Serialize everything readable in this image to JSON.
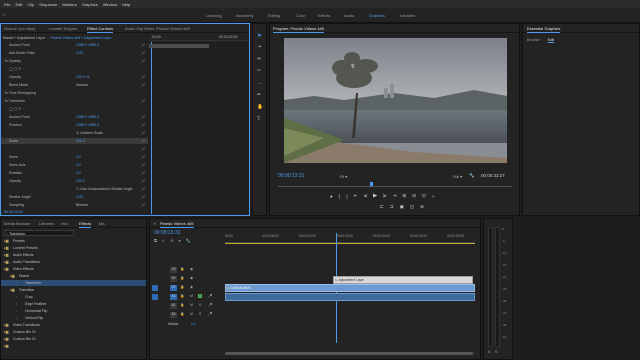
{
  "menu": [
    "File",
    "Edit",
    "Clip",
    "Sequence",
    "Markers",
    "Graphics",
    "Window",
    "Help"
  ],
  "workspaces": [
    {
      "label": "Learning",
      "active": false
    },
    {
      "label": "Assembly",
      "active": false
    },
    {
      "label": "Editing",
      "active": false
    },
    {
      "label": "Color",
      "active": false
    },
    {
      "label": "Effects",
      "active": false
    },
    {
      "label": "Audio",
      "active": false
    },
    {
      "label": "Graphics",
      "active": true
    },
    {
      "label": "Libraries",
      "active": false
    }
  ],
  "source_tabs": [
    "Source: (no clips)",
    "Lumetri Scopes",
    "Effect Controls",
    "Audio Clip Mixer: Pinedo Videos 4#5"
  ],
  "effect_controls": {
    "master_label": "Master * Adjustment Layer",
    "sequence_label": "Pinedo Videos 4#5 * Adjustment Layer",
    "tc_start": ";00;00",
    "tc_end": "00;00;02;00",
    "rows": [
      {
        "indent": 8,
        "label": "Anchor Point",
        "value": "1080.0    1080.0",
        "reset": true,
        "sel": false
      },
      {
        "indent": 8,
        "label": "Anti-flicker Filter",
        "value": "0.00",
        "reset": true,
        "sel": false
      },
      {
        "indent": 4,
        "label": "fx  Opacity",
        "value": "",
        "reset": true,
        "sel": false
      },
      {
        "indent": 8,
        "label": "◯ ▢ ✎",
        "value": "",
        "reset": false,
        "sel": false
      },
      {
        "indent": 8,
        "label": "Opacity",
        "value": "100.0 %",
        "reset": true,
        "sel": false
      },
      {
        "indent": 8,
        "label": "Blend Mode",
        "value": "Normal",
        "reset": true,
        "sel": false
      },
      {
        "indent": 4,
        "label": "fx  Time Remapping",
        "value": "",
        "reset": false,
        "sel": false
      },
      {
        "indent": 4,
        "label": "fx  Transform",
        "value": "",
        "reset": true,
        "sel": false
      },
      {
        "indent": 8,
        "label": "◯ ▢ ✎",
        "value": "",
        "reset": false,
        "sel": false
      },
      {
        "indent": 8,
        "label": "Anchor Point",
        "value": "1080.0    1080.0",
        "reset": true,
        "sel": false
      },
      {
        "indent": 8,
        "label": "Position",
        "value": "1080.0    1080.0",
        "reset": true,
        "sel": false
      },
      {
        "indent": 8,
        "label": "",
        "value": "☑ Uniform Scale",
        "reset": true,
        "sel": false
      },
      {
        "indent": 8,
        "label": "Scale",
        "value": "210.4",
        "reset": true,
        "sel": true
      },
      {
        "indent": 8,
        "label": "",
        "value": "",
        "reset": true,
        "sel": false
      },
      {
        "indent": 8,
        "label": "Skew",
        "value": "0.0",
        "reset": true,
        "sel": false
      },
      {
        "indent": 8,
        "label": "Skew Axis",
        "value": "0.0",
        "reset": true,
        "sel": false
      },
      {
        "indent": 8,
        "label": "Rotation",
        "value": "0.0",
        "reset": true,
        "sel": false
      },
      {
        "indent": 8,
        "label": "Opacity",
        "value": "100.0",
        "reset": true,
        "sel": false
      },
      {
        "indent": 8,
        "label": "",
        "value": "☐ Use Composition's Shutter Angle",
        "reset": true,
        "sel": false
      },
      {
        "indent": 8,
        "label": "Shutter Angle",
        "value": "0.00",
        "reset": true,
        "sel": false
      },
      {
        "indent": 8,
        "label": "Sampling",
        "value": "Bilinear",
        "reset": true,
        "sel": false
      }
    ],
    "footer_tc": "00:00:13:31"
  },
  "program": {
    "title": "Program: Pinedo Videos 4#5",
    "timecode": "00:00:13:31",
    "fit": "Fit",
    "quality": "Full",
    "duration": "00:00:33:27"
  },
  "essential_graphics": {
    "title": "Essential Graphics",
    "tabs": [
      "Browse",
      "Edit"
    ],
    "active_tab": "Edit"
  },
  "project_tabs": [
    "Media Browser",
    "Libraries",
    "Info",
    "Effects",
    "Ma"
  ],
  "effects_search": "Transform",
  "effects_tree": [
    {
      "indent": 0,
      "label": "Presets",
      "type": "folder",
      "sel": false
    },
    {
      "indent": 0,
      "label": "Lumetri Presets",
      "type": "folder",
      "sel": false
    },
    {
      "indent": 0,
      "label": "Audio Effects",
      "type": "folder",
      "sel": false
    },
    {
      "indent": 0,
      "label": "Audio Transitions",
      "type": "folder",
      "sel": false
    },
    {
      "indent": 0,
      "label": "Video Effects",
      "type": "folder",
      "sel": false
    },
    {
      "indent": 1,
      "label": "Distort",
      "type": "folder",
      "sel": false
    },
    {
      "indent": 2,
      "label": "Transform",
      "type": "fx",
      "sel": true
    },
    {
      "indent": 1,
      "label": "Transition",
      "type": "folder",
      "sel": false
    },
    {
      "indent": 2,
      "label": "Crop",
      "type": "fx",
      "sel": false
    },
    {
      "indent": 2,
      "label": "Edge Feather",
      "type": "fx",
      "sel": false
    },
    {
      "indent": 2,
      "label": "Horizontal Flip",
      "type": "fx",
      "sel": false
    },
    {
      "indent": 2,
      "label": "Vertical Flip",
      "type": "fx",
      "sel": false
    },
    {
      "indent": 0,
      "label": "Video Transitions",
      "type": "folder",
      "sel": false
    },
    {
      "indent": 0,
      "label": "Custom Bin 01",
      "type": "folder",
      "sel": false
    },
    {
      "indent": 0,
      "label": "Custom Bin 01",
      "type": "folder",
      "sel": false
    },
    {
      "indent": 0,
      "label": "",
      "type": "folder",
      "sel": false
    }
  ],
  "timeline": {
    "title": "Pinedo Videos 4#5",
    "timecode": "00:00:13:31",
    "ruler": [
      "00:00",
      "00:00:05:00",
      "00:00:10:00",
      "00:00:15:00",
      "00:00:20:00",
      "00:00:25:00",
      "00:00:30:00"
    ],
    "tracks": [
      {
        "name": "V3",
        "kind": "video"
      },
      {
        "name": "V2",
        "kind": "video"
      },
      {
        "name": "V1",
        "kind": "video"
      },
      {
        "name": "A1",
        "kind": "audio"
      },
      {
        "name": "A2",
        "kind": "audio"
      },
      {
        "name": "A3",
        "kind": "audio"
      }
    ],
    "master_label": "Master",
    "master_value": "0.0",
    "adjustment_clip": "Adjustment Layer",
    "video_clip": "DJI0446.MOV"
  },
  "meter_labels": [
    "0",
    "-6",
    "-12",
    "-18",
    "-24",
    "-30",
    "-36",
    "-42",
    "-48",
    "-54"
  ]
}
